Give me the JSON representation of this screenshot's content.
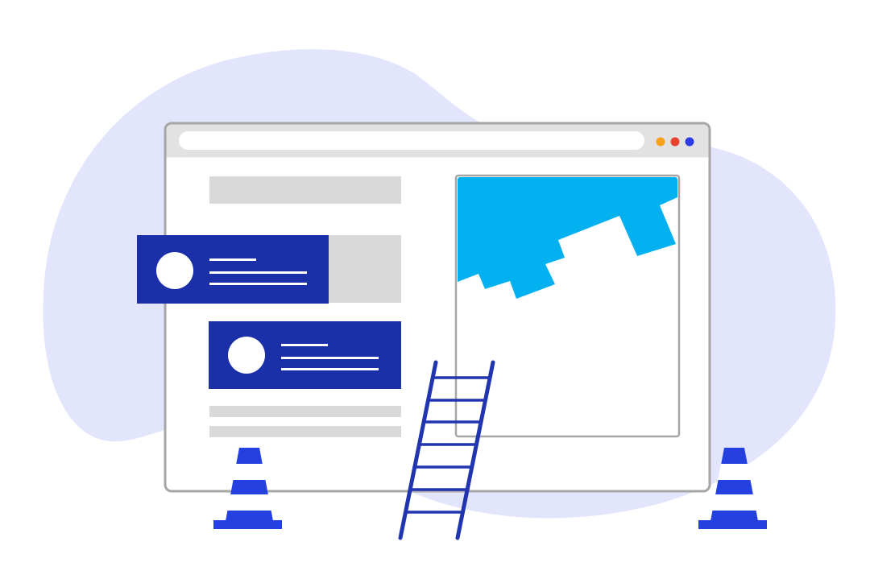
{
  "palette": {
    "background": "#ffffff",
    "blob": "#e3e5fd",
    "window_border": "#a6a6a6",
    "window_fill": "#ffffff",
    "titlebar": "#e2e2e2",
    "address_bar": "#ffffff",
    "placeholder": "#d9d9d9",
    "card": "#1b2fa8",
    "card_detail": "#ffffff",
    "image_accent": "#03b0f0",
    "ladder": "#2235b0",
    "cone": "#2440e0",
    "dot_orange": "#f8a21b",
    "dot_red": "#e8422e",
    "dot_blue": "#2c3be0"
  },
  "icons": {
    "window_controls": [
      "dot-orange-icon",
      "dot-red-icon",
      "dot-blue-icon"
    ],
    "cards": [
      "avatar-icon",
      "avatar-icon"
    ],
    "props": [
      "ladder-icon",
      "traffic-cone-icon",
      "traffic-cone-icon"
    ]
  }
}
